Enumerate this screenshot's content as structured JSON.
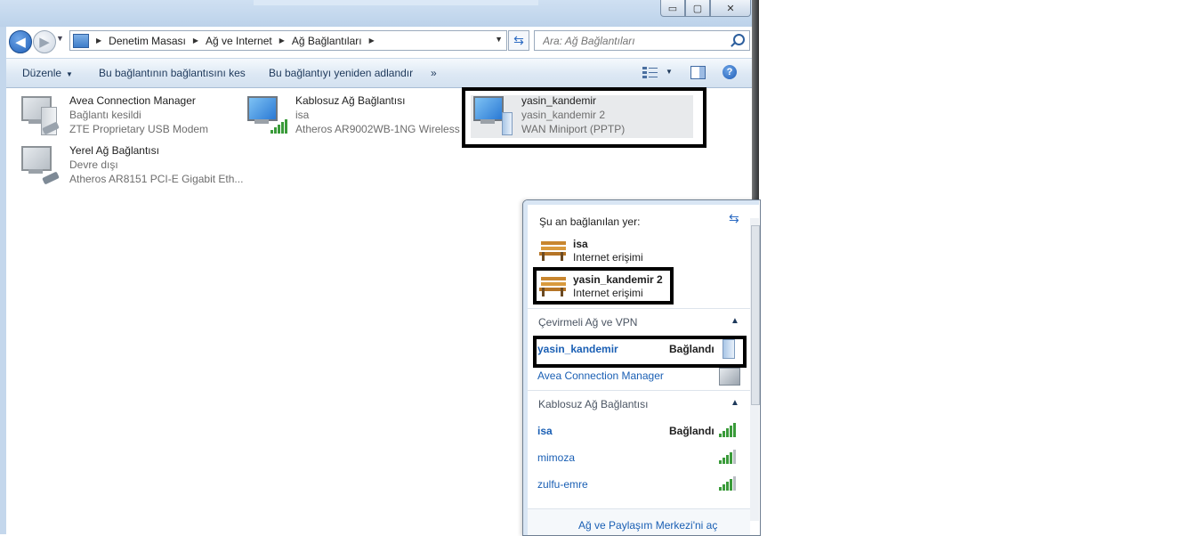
{
  "window": {
    "buttons": {
      "minimize": "▭",
      "maximize": "▢",
      "close": "✕"
    }
  },
  "address_bar": {
    "crumbs": [
      "Denetim Masası",
      "Ağ ve Internet",
      "Ağ Bağlantıları"
    ],
    "search_placeholder": "Ara: Ağ Bağlantıları"
  },
  "toolbar": {
    "organize": "Düzenle",
    "disconnect": "Bu bağlantının bağlantısını kes",
    "rename": "Bu bağlantıyı yeniden adlandır",
    "more": "»"
  },
  "connections": [
    {
      "name": "Avea Connection Manager",
      "status": "Bağlantı kesildi",
      "device": "ZTE Proprietary USB Modem",
      "icon": "modem-icon"
    },
    {
      "name": "Kablosuz Ağ Bağlantısı",
      "status": "isa",
      "device": "Atheros AR9002WB-1NG Wireless ...",
      "icon": "wireless-icon"
    },
    {
      "name": "yasin_kandemir",
      "status": "yasin_kandemir  2",
      "device": "WAN Miniport (PPTP)",
      "icon": "vpn-icon"
    },
    {
      "name": "Yerel Ağ Bağlantısı",
      "status": "Devre dışı",
      "device": "Atheros AR8151 PCI-E Gigabit Eth...",
      "icon": "ethernet-icon"
    }
  ],
  "flyout": {
    "header": "Şu an bağlanılan yer:",
    "current": [
      {
        "name": "isa",
        "access": "Internet erişimi"
      },
      {
        "name": "yasin_kandemir  2",
        "access": "Internet erişimi"
      }
    ],
    "dialup_section": "Çevirmeli Ağ ve VPN",
    "dialup": [
      {
        "name": "yasin_kandemir",
        "state": "Bağlandı"
      },
      {
        "name": "Avea Connection Manager",
        "state": ""
      }
    ],
    "wireless_section": "Kablosuz Ağ Bağlantısı",
    "wireless": [
      {
        "name": "isa",
        "state": "Bağlandı",
        "signal": 5
      },
      {
        "name": "mimoza",
        "state": "",
        "signal": 4
      },
      {
        "name": "zulfu-emre",
        "state": "",
        "signal": 4
      }
    ],
    "footer": "Ağ ve Paylaşım Merkezi'ni aç"
  },
  "colors": {
    "link": "#1a5fb4",
    "highlight_border": "#000000",
    "signal_green": "#3a9b3a"
  }
}
